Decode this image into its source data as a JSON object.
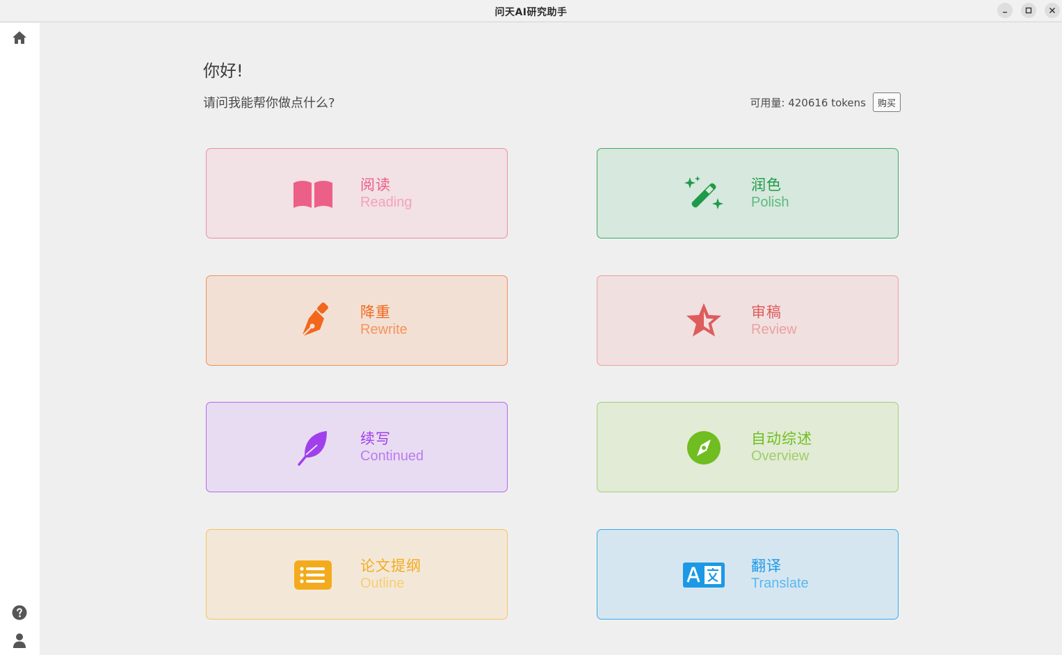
{
  "window": {
    "title": "问天AI研究助手",
    "controls": [
      "minimize-icon",
      "maximize-icon",
      "close-icon"
    ]
  },
  "sidebar": {
    "top_icons": [
      "home-icon"
    ],
    "bottom_icons": [
      "help-icon",
      "user-icon"
    ]
  },
  "main": {
    "greeting": "你好!",
    "subtitle": "请问我能帮你做点什么?",
    "quota_text": "可用量: 420616 tokens",
    "buy_label": "购买"
  },
  "cards": [
    {
      "cn": "阅读",
      "en": "Reading",
      "icon": "book-icon",
      "color": "#ec5f86"
    },
    {
      "cn": "润色",
      "en": "Polish",
      "icon": "magic-wand-icon",
      "color": "#1f9a48"
    },
    {
      "cn": "降重",
      "en": "Rewrite",
      "icon": "pen-nib-icon",
      "color": "#f2671d"
    },
    {
      "cn": "审稿",
      "en": "Review",
      "icon": "star-icon",
      "color": "#de5c5c"
    },
    {
      "cn": "续写",
      "en": "Continued",
      "icon": "feather-icon",
      "color": "#a040ec"
    },
    {
      "cn": "自动综述",
      "en": "Overview",
      "icon": "compass-icon",
      "color": "#6fbd20"
    },
    {
      "cn": "论文提纲",
      "en": "Outline",
      "icon": "list-icon",
      "color": "#f3ab1d"
    },
    {
      "cn": "翻译",
      "en": "Translate",
      "icon": "translate-icon",
      "color": "#1b99e6"
    }
  ]
}
